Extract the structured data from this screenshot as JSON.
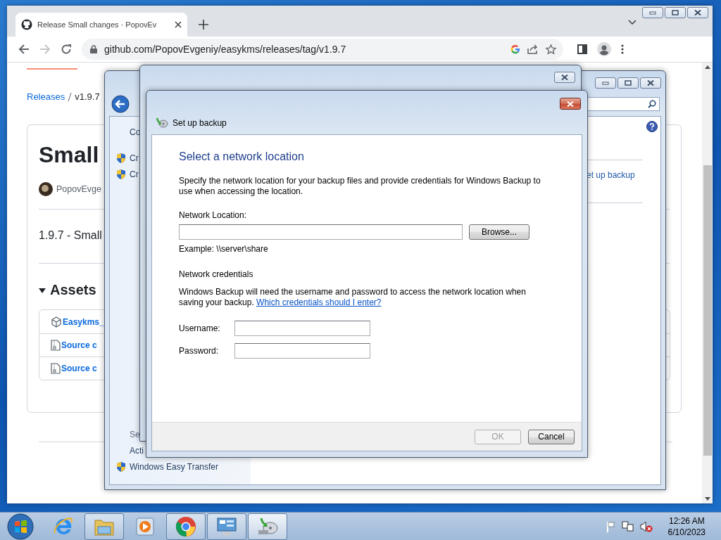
{
  "browser": {
    "tab": {
      "title": "Release Small changes · PopovEv",
      "selected": true
    },
    "address": "github.com/PopovEvgeniy/easykms/releases/tag/v1.9.7",
    "forward_disabled": true
  },
  "github": {
    "breadcrumb": [
      "Releases",
      "v1.9.7"
    ],
    "title": "Small",
    "author": "PopovEvge",
    "body": "1.9.7 - Small",
    "assets_heading": "Assets",
    "assets_expanded": true,
    "assets": [
      {
        "kind": "package",
        "name": "Easykms_"
      },
      {
        "kind": "zip",
        "name": "Source c"
      },
      {
        "kind": "zip",
        "name": "Source c"
      }
    ]
  },
  "control_panel": {
    "sidebar": [
      {
        "kind": "link",
        "text": "Co"
      },
      {
        "kind": "shield",
        "text": "Cr"
      },
      {
        "kind": "shield",
        "text": "Cr"
      },
      {
        "kind": "heading",
        "text": "Se"
      },
      {
        "kind": "link",
        "text": "Acti"
      },
      {
        "kind": "shield",
        "text": "Windows Easy Transfer"
      }
    ],
    "link": "et up backup"
  },
  "dialog": {
    "title": "Set up backup",
    "heading": "Select a network location",
    "intro": "Specify the network location for your backup files and provide credentials for Windows Backup to use when accessing the location.",
    "location_label": "Network Location:",
    "browse": "Browse...",
    "example": "Example: \\\\server\\share",
    "credentials_heading": "Network credentials",
    "credentials_text": "Windows Backup will need the username and password to access the network location when saving your backup.",
    "credentials_link": "Which credentials should I enter?",
    "fields": [
      {
        "label": "Username:"
      },
      {
        "label": "Password:"
      }
    ],
    "buttons": [
      {
        "label": "OK",
        "disabled": true
      },
      {
        "label": "Cancel",
        "disabled": false
      }
    ]
  },
  "taskbar": {
    "apps": [
      {
        "kind": "ie",
        "running": false,
        "active": false
      },
      {
        "kind": "explorer",
        "running": true,
        "active": false
      },
      {
        "kind": "media",
        "running": false,
        "active": false
      },
      {
        "kind": "chrome",
        "running": true,
        "active": false
      },
      {
        "kind": "control",
        "running": true,
        "active": false
      },
      {
        "kind": "backup",
        "running": true,
        "active": true
      }
    ],
    "time": "12:26 AM",
    "date": "6/10/2023"
  }
}
